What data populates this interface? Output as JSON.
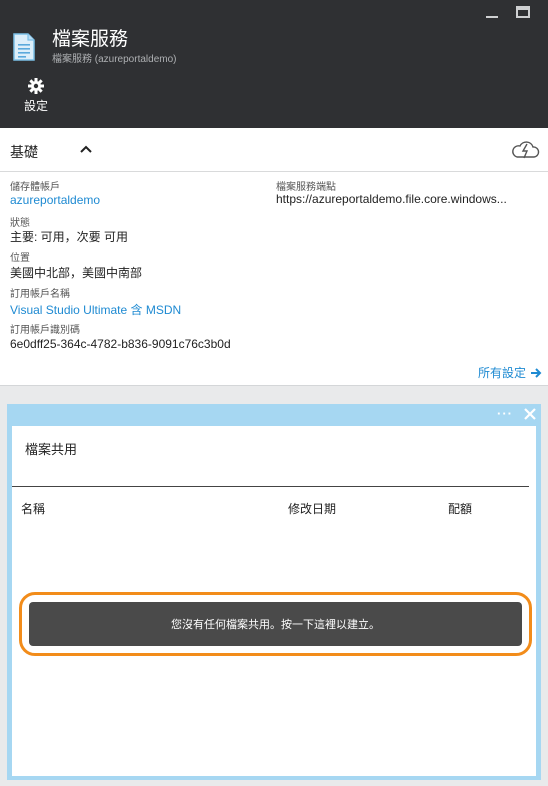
{
  "header": {
    "title": "檔案服務",
    "subtitle": "檔案服務 (azureportaldemo)",
    "settings_label": "設定"
  },
  "essentials": {
    "title": "基礎",
    "fields": {
      "storage_account": {
        "label": "儲存體帳戶",
        "value": "azureportaldemo"
      },
      "status": {
        "label": "狀態",
        "value": "主要: 可用，次要 可用"
      },
      "location": {
        "label": "位置",
        "value": "美國中北部，美國中南部"
      },
      "subscription_name": {
        "label": "訂用帳戶名稱",
        "value": "Visual Studio Ultimate 含 MSDN"
      },
      "subscription_id": {
        "label": "訂用帳戶識別碼",
        "value": "6e0dff25-364c-4782-b836-9091c76c3b0d"
      },
      "endpoint": {
        "label": "檔案服務端點",
        "value": "https://azureportaldemo.file.core.windows..."
      }
    },
    "all_settings": "所有設定"
  },
  "file_shares": {
    "title": "檔案共用",
    "columns": [
      "名稱",
      "修改日期",
      "配額"
    ],
    "empty_message": "您沒有任何檔案共用。按一下這裡以建立。"
  },
  "colors": {
    "header_bg": "#2f3033",
    "link": "#1e8ad2",
    "part_border": "#a6d7f2",
    "highlight": "#f28c1a",
    "banner_bg": "#4a4a4a"
  },
  "icons": {
    "app": "document-icon",
    "settings": "gear-icon",
    "collapse": "chevron-up-icon",
    "cloud": "cloud-lightning-icon",
    "all_settings": "arrow-right-icon",
    "more": "ellipsis-icon",
    "close": "close-icon"
  }
}
